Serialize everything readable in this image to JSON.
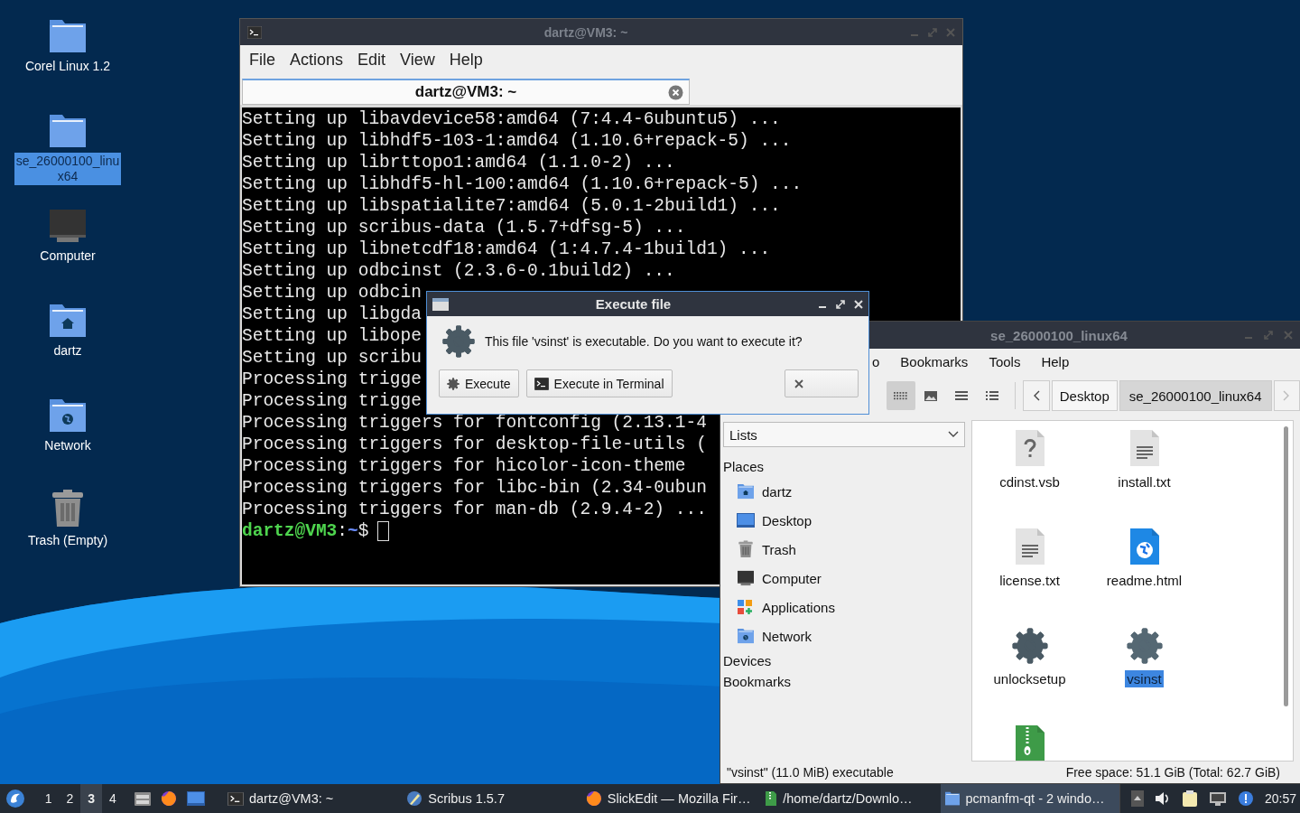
{
  "desktop_icons": [
    {
      "label": "Corel Linux 1.2",
      "kind": "folder",
      "selected": false
    },
    {
      "label": "se_26000100_linux64",
      "kind": "folder",
      "selected": true
    },
    {
      "label": "Computer",
      "kind": "computer",
      "selected": false
    },
    {
      "label": "dartz",
      "kind": "home",
      "selected": false
    },
    {
      "label": "Network",
      "kind": "network",
      "selected": false
    },
    {
      "label": "Trash (Empty)",
      "kind": "trash",
      "selected": false
    }
  ],
  "terminal": {
    "title": "dartz@VM3: ~",
    "menu": [
      "File",
      "Actions",
      "Edit",
      "View",
      "Help"
    ],
    "tab": {
      "label": "dartz@VM3: ~",
      "selected": true
    },
    "lines": [
      "Setting up libavdevice58:amd64 (7:4.4-6ubuntu5) ...",
      "Setting up libhdf5-103-1:amd64 (1.10.6+repack-5) ...",
      "Setting up librttopo1:amd64 (1.1.0-2) ...",
      "Setting up libhdf5-hl-100:amd64 (1.10.6+repack-5) ...",
      "Setting up libspatialite7:amd64 (5.0.1-2build1) ...",
      "Setting up scribus-data (1.5.7+dfsg-5) ...",
      "Setting up libnetcdf18:amd64 (1:4.7.4-1build1) ...",
      "Setting up odbcinst (2.3.6-0.1build2) ...",
      "Setting up odbcin",
      "Setting up libgda",
      "Setting up libope",
      "Setting up scribu",
      "Processing trigge",
      "Processing trigge",
      "Processing triggers for fontconfig (2.13.1-4",
      "Processing triggers for desktop-file-utils (",
      "Processing triggers for hicolor-icon-theme",
      "Processing triggers for libc-bin (2.34-0ubun",
      "Processing triggers for man-db (2.9.4-2) ..."
    ],
    "prompt": {
      "user_host": "dartz@VM3",
      "separator": ":",
      "path": "~",
      "symbol": "$"
    }
  },
  "dialog": {
    "title": "Execute file",
    "message": "This file 'vsinst' is executable. Do you want to execute it?",
    "buttons": [
      {
        "label": "Execute",
        "kind": "execute"
      },
      {
        "label": "Execute in Terminal",
        "kind": "terminal"
      },
      {
        "kind": "cancel"
      }
    ]
  },
  "file_manager": {
    "title": "se_26000100_linux64",
    "menu": [
      "o",
      "Bookmarks",
      "Tools",
      "Help"
    ],
    "view_modes": [
      {
        "kind": "icons",
        "selected": true
      },
      {
        "kind": "thumbnails",
        "selected": false
      },
      {
        "kind": "compact",
        "selected": false
      },
      {
        "kind": "details",
        "selected": false
      }
    ],
    "path": [
      {
        "label": "Desktop",
        "selected": false
      },
      {
        "label": "se_26000100_linux64",
        "selected": true
      }
    ],
    "sidebar": {
      "mode": "Lists",
      "sections": [
        {
          "label": "Places",
          "items": [
            {
              "label": "dartz",
              "kind": "home"
            },
            {
              "label": "Desktop",
              "kind": "desktop"
            },
            {
              "label": "Trash",
              "kind": "trash"
            },
            {
              "label": "Computer",
              "kind": "computer"
            },
            {
              "label": "Applications",
              "kind": "applications"
            },
            {
              "label": "Network",
              "kind": "network"
            }
          ]
        },
        {
          "label": "Devices"
        },
        {
          "label": "Bookmarks"
        }
      ]
    },
    "files": [
      {
        "name": "cdinst.vsb",
        "kind": "unknown",
        "selected": false
      },
      {
        "name": "install.txt",
        "kind": "text",
        "selected": false
      },
      {
        "name": "license.txt",
        "kind": "text",
        "selected": false
      },
      {
        "name": "readme.html",
        "kind": "html",
        "selected": false
      },
      {
        "name": "unlocksetup",
        "kind": "executable",
        "selected": false
      },
      {
        "name": "vsinst",
        "kind": "executable",
        "selected": true
      },
      {
        "kind": "archive",
        "selected": false
      }
    ],
    "status": {
      "selection": "\"vsinst\" (11.0 MiB) executable",
      "free_space": "Free space: 51.1 GiB (Total: 62.7 GiB)"
    }
  },
  "taskbar": {
    "workspaces": [
      {
        "label": "1",
        "selected": false
      },
      {
        "label": "2",
        "selected": false
      },
      {
        "label": "3",
        "selected": true
      },
      {
        "label": "4",
        "selected": false
      }
    ],
    "tasks": [
      {
        "label": "dartz@VM3: ~",
        "kind": "terminal",
        "selected": false
      },
      {
        "label": "Scribus 1.5.7",
        "kind": "scribus",
        "selected": false
      },
      {
        "label": "SlickEdit — Mozilla Fir…",
        "kind": "browser",
        "selected": false
      },
      {
        "label": "/home/dartz/Downlo…",
        "kind": "archive",
        "selected": false
      },
      {
        "label": "pcmanfm-qt - 2 windo…",
        "kind": "folder",
        "selected": true
      }
    ],
    "clock": "20:57"
  }
}
